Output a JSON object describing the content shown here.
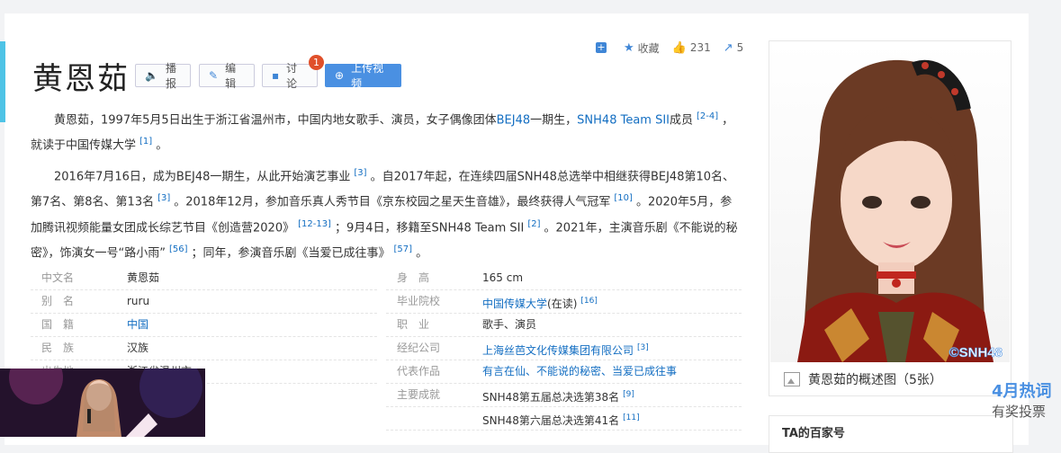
{
  "actions": {
    "add_icon": "plus-square-icon",
    "favorite_label": "收藏",
    "like_count": "231",
    "share_count": "5"
  },
  "title": "黄恩茹",
  "buttons": {
    "play": "播报",
    "edit": "编辑",
    "discuss": "讨论",
    "discuss_badge": "1",
    "upload": "上传视频"
  },
  "para1": {
    "t1": "黄恩茹，1997年5月5日出生于浙江省温州市，中国内地女歌手、演员，女子偶像团体",
    "link1": "BEJ48",
    "t2": "一期生，",
    "link2": "SNH48 Team SII",
    "t3": "成员",
    "ref1": "[2-4]",
    "t4": "，就读于中国传媒大学",
    "ref2": "[1]",
    "t5": "。"
  },
  "para2": {
    "t1": "2016年7月16日，成为BEJ48一期生，从此开始演艺事业",
    "r1": "[3]",
    "t2": "。自2017年起，在连续四届SNH48总选举中相继获得BEJ48第10名、第7名、第8名、第13名",
    "r2": "[3]",
    "t3": "。2018年12月，参加音乐真人秀节目《京东校园之星天生音雄》，最终获得人气冠军",
    "r3": "[10]",
    "t4": "。2020年5月，参加腾讯视频能量女团成长综艺节目《创造营2020》",
    "r4": "[12-13]",
    "t5": "；9月4日，移籍至SNH48 Team SII",
    "r5": "[2]",
    "t6": "。2021年，主演音乐剧《不能说的秘密》，饰演女一号“路小雨”",
    "r6": "[56]",
    "t7": "；同年，参演音乐剧《当爱已成往事》",
    "r7": "[57]",
    "t8": "。"
  },
  "info_left": [
    {
      "label": "中文名",
      "value": "黄恩茹"
    },
    {
      "label": "别　名",
      "value": "ruru"
    },
    {
      "label": "国　籍",
      "value": "中国"
    },
    {
      "label": "民　族",
      "value": "汉族"
    },
    {
      "label": "出生地",
      "value": "浙江省温州市"
    }
  ],
  "info_right": [
    {
      "label": "身　高",
      "value": "165 cm"
    },
    {
      "label": "毕业院校",
      "value": "中国传媒大学",
      "suffix": "(在读)",
      "ref": "[16]"
    },
    {
      "label": "职　业",
      "value": "歌手、演员"
    },
    {
      "label": "经纪公司",
      "value": "上海丝芭文化传媒集团有限公司",
      "ref": "[3]"
    },
    {
      "label": "代表作品",
      "value": "有言在仙、不能说的秘密、当爱已成往事"
    },
    {
      "label": "主要成就",
      "value": "SNH48第五届总决选第38名",
      "ref": "[9]"
    },
    {
      "label": "",
      "value": "SNH48第六届总决选第41名",
      "ref": "[11]"
    }
  ],
  "photo": {
    "watermark": "©SNH48",
    "caption": "黄恩茹的概述图（5张）"
  },
  "panel2_title": "TA的百家号",
  "float_ad": {
    "line1": "4月热词",
    "line2": "有奖投票"
  }
}
